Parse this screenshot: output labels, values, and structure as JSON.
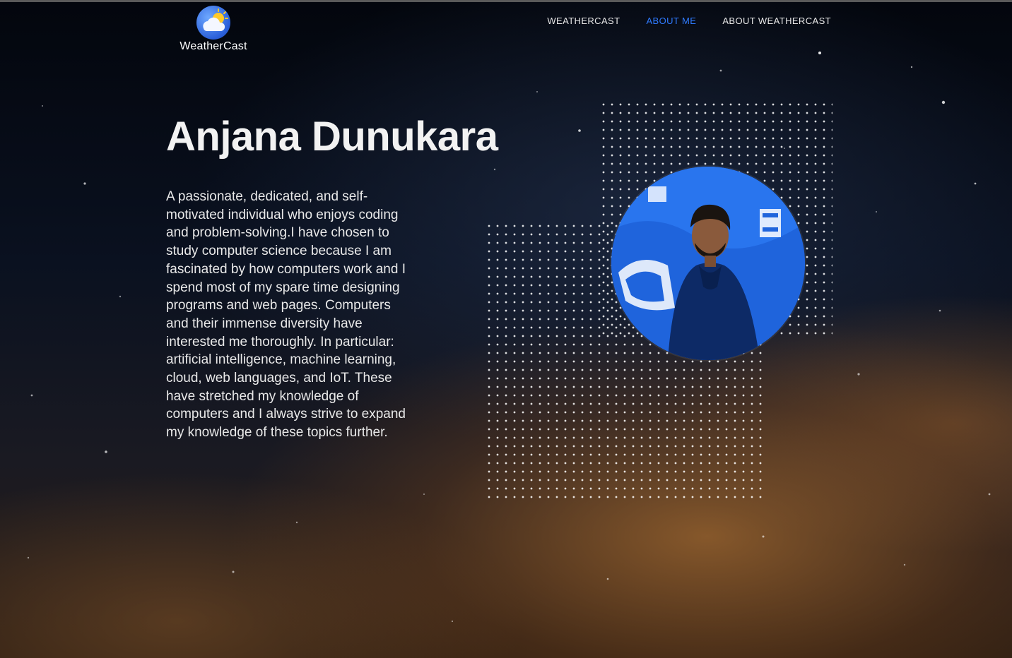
{
  "header": {
    "logo_text": "WeatherCast",
    "logo_icon": "cloud-sun-icon",
    "nav": [
      {
        "label": "WEATHERCAST"
      },
      {
        "label": "ABOUT ME"
      },
      {
        "label": "ABOUT WEATHERCAST"
      }
    ],
    "active_nav": "ABOUT ME"
  },
  "main": {
    "name": "Anjana Dunukara",
    "bio": "A passionate, dedicated, and self-motivated individual who enjoys coding and problem-solving.I have chosen to study computer science because I am fascinated by how computers work and I spend most of my spare time designing programs and web pages. Computers and their immense diversity have interested me thoroughly. In particular: artificial intelligence, machine learning, cloud, web languages, and IoT. These have stretched my knowledge of computers and I always strive to expand my knowledge of these topics further."
  },
  "colors": {
    "accent": "#2f7bff",
    "text": "#ffffff",
    "portrait_bg": "#1a5fd6"
  }
}
